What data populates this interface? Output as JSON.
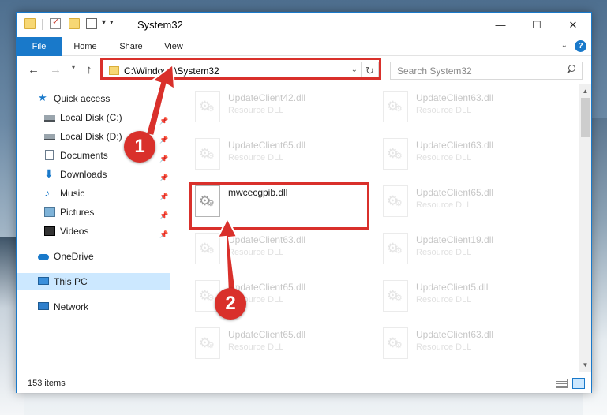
{
  "window": {
    "title": "System32",
    "controls": {
      "minimize": "—",
      "maximize": "☐",
      "close": "✕"
    }
  },
  "ribbon": {
    "tabs": [
      "File",
      "Home",
      "Share",
      "View"
    ]
  },
  "address": {
    "path": "C:\\Windows\\System32"
  },
  "search": {
    "placeholder": "Search System32"
  },
  "sidebar": {
    "items": [
      {
        "label": "Quick access",
        "icon": "quick-access-star-icon"
      },
      {
        "label": "Local Disk (C:)",
        "icon": "drive-icon",
        "pinned": true
      },
      {
        "label": "Local Disk (D:)",
        "icon": "drive-icon",
        "pinned": true
      },
      {
        "label": "Documents",
        "icon": "documents-icon",
        "pinned": true
      },
      {
        "label": "Downloads",
        "icon": "downloads-icon",
        "pinned": true
      },
      {
        "label": "Music",
        "icon": "music-icon",
        "pinned": true
      },
      {
        "label": "Pictures",
        "icon": "pictures-icon",
        "pinned": true
      },
      {
        "label": "Videos",
        "icon": "videos-icon",
        "pinned": true
      },
      {
        "label": "OneDrive",
        "icon": "onedrive-icon"
      },
      {
        "label": "This PC",
        "icon": "this-pc-icon",
        "selected": true
      },
      {
        "label": "Network",
        "icon": "network-icon"
      }
    ]
  },
  "files": [
    {
      "name": "UpdateClient42.dll",
      "type": "Resource DLL",
      "faded": true
    },
    {
      "name": "UpdateClient63.dll",
      "type": "Resource DLL",
      "faded": true
    },
    {
      "name": "UpdateClient65.dll",
      "type": "Resource DLL",
      "faded": true
    },
    {
      "name": "UpdateClient63.dll",
      "type": "Resource DLL",
      "faded": true
    },
    {
      "name": "mwcecgpib.dll",
      "type": "",
      "faded": false
    },
    {
      "name": "UpdateClient65.dll",
      "type": "Resource DLL",
      "faded": true
    },
    {
      "name": "UpdateClient63.dll",
      "type": "Resource DLL",
      "faded": true
    },
    {
      "name": "UpdateClient19.dll",
      "type": "Resource DLL",
      "faded": true
    },
    {
      "name": "UpdateClient65.dll",
      "type": "Resource DLL",
      "faded": true
    },
    {
      "name": "UpdateClient5.dll",
      "type": "Resource DLL",
      "faded": true
    },
    {
      "name": "UpdateClient65.dll",
      "type": "Resource DLL",
      "faded": true
    },
    {
      "name": "UpdateClient63.dll",
      "type": "Resource DLL",
      "faded": true
    }
  ],
  "status": {
    "item_count": "153 items"
  },
  "callouts": {
    "step1": "1",
    "step2": "2",
    "color": "#d9302b"
  }
}
